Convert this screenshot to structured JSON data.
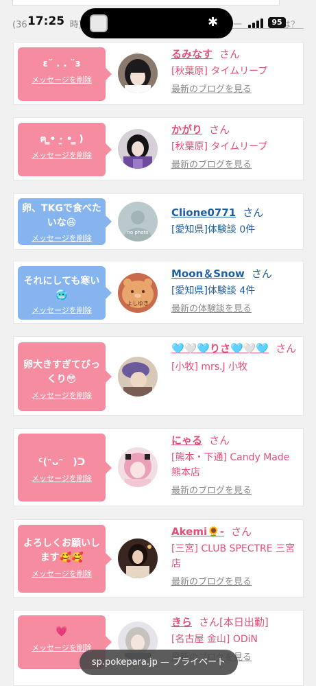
{
  "status": {
    "time": "17:25",
    "behind_left": "(36",
    "behind_left_end": "時)",
    "behind_right": "一",
    "behind_right_end": "は？",
    "battery": "95"
  },
  "browser": {
    "url_text": "sp.pokepara.jp — プライベート"
  },
  "cards": [
    {
      "type": "pink",
      "message": "ε˘ . . ˘з",
      "delete_label": "メッセージを削除",
      "name": "るみなす",
      "san": "さん",
      "shop": "[秋葉原] タイムリープ",
      "link": "最新のブログを見る",
      "avatar": "dark-hair-girl"
    },
    {
      "type": "pink",
      "message": "ฅ ̳• ·̫ • ̳ )",
      "delete_label": "メッセージを削除",
      "name": "かがり",
      "san": "さん",
      "shop": "[秋葉原] タイムリープ",
      "link": "最新のブログを見る",
      "avatar": "purple-kimono"
    },
    {
      "type": "blue",
      "message": "卵、TKGで食べたいな😆",
      "delete_label": "メッセージを削除",
      "name": "Clione0771",
      "san": "さん",
      "shop": "[愛知県]体験談 0件",
      "link": "",
      "avatar": "no-photo",
      "avatar_text": "no photo"
    },
    {
      "type": "blue",
      "message": "それにしても寒い🥶",
      "delete_label": "メッセージを削除",
      "name": "Moon＆Snow",
      "san": "さん",
      "shop": "[愛知県]体験談 4件",
      "link": "最新の体験談を見る",
      "avatar": "bear-toast",
      "avatar_text": "よしゆき"
    },
    {
      "type": "pink",
      "message": "卵大きすぎてびっくり😳",
      "delete_label": "メッセージを削除",
      "name": "🩵🤍🩵りさ🩵🤍🩵",
      "san": "さん",
      "shop": "[小牧] mrs.J 小牧",
      "link": "",
      "avatar": "purple-hat"
    },
    {
      "type": "pink",
      "message": "ᑦ(ᵔᴗᵔ　)ᑐ",
      "delete_label": "メッセージを削除",
      "name": "にゃる",
      "san": "さん",
      "shop": "[熊本・下通] Candy Made 熊本店",
      "link": "最新のブログを見る",
      "avatar": "pink-hair"
    },
    {
      "type": "pink",
      "message": "よろしくお願いします🥰🥰",
      "delete_label": "メッセージを削除",
      "name": "Akemi🌻-",
      "san": "さん",
      "shop": "[三宮] CLUB SPECTRE 三宮店",
      "link": "最新のブログを見る",
      "avatar": "dark-room"
    },
    {
      "type": "pink",
      "message": "💗",
      "delete_label": "メッセージを削除",
      "name": "きら",
      "san": "さん[本日出勤]",
      "shop": "[名古屋 金山] ODiN",
      "link": "最新のブログを見る",
      "avatar": "light-hair"
    }
  ]
}
